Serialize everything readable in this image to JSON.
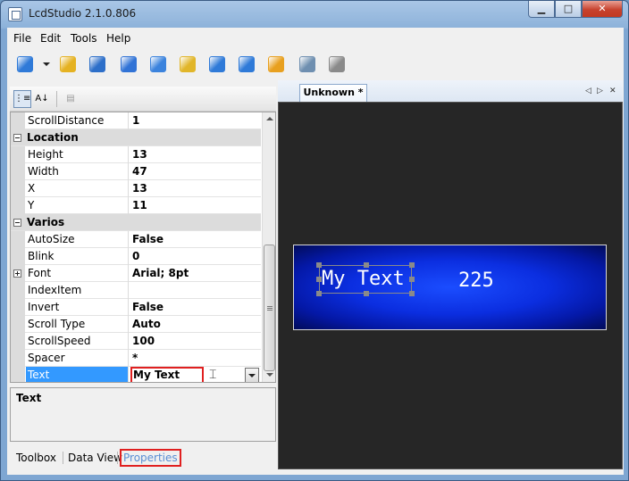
{
  "window": {
    "title": "LcdStudio 2.1.0.806",
    "min_glyph": "▁",
    "max_glyph": "□",
    "close_glyph": "✕"
  },
  "menu": [
    "File",
    "Edit",
    "Tools",
    "Help"
  ],
  "toolbar_icons": [
    {
      "name": "new-icon",
      "color": "#2f7ad8"
    },
    {
      "name": "open-icon",
      "color": "#e5b222"
    },
    {
      "name": "save-icon",
      "color": "#2d6fc9"
    },
    {
      "name": "cut-icon",
      "color": "#3173d6"
    },
    {
      "name": "copy-icon",
      "color": "#3b83dd"
    },
    {
      "name": "paste-icon",
      "color": "#e1b62a"
    },
    {
      "name": "undo-icon",
      "color": "#2f7ad8"
    },
    {
      "name": "redo-icon",
      "color": "#2f7ad8"
    },
    {
      "name": "tools-icon",
      "color": "#e8a01f"
    },
    {
      "name": "print-icon",
      "color": "#6f8fb0"
    },
    {
      "name": "camera-icon",
      "color": "#8a8a8a"
    }
  ],
  "property_grid": {
    "sort_categorized_glyph": "⋮≡",
    "sort_alpha_glyph": "A↓",
    "pages_glyph": "▤",
    "rows": [
      {
        "kind": "prop",
        "name": "ScrollDistance",
        "value": "1"
      },
      {
        "kind": "cat",
        "name": "Location"
      },
      {
        "kind": "prop",
        "name": "Height",
        "value": "13"
      },
      {
        "kind": "prop",
        "name": "Width",
        "value": "47"
      },
      {
        "kind": "prop",
        "name": "X",
        "value": "13"
      },
      {
        "kind": "prop",
        "name": "Y",
        "value": "11"
      },
      {
        "kind": "cat",
        "name": "Varios"
      },
      {
        "kind": "prop",
        "name": "AutoSize",
        "value": "False"
      },
      {
        "kind": "prop",
        "name": "Blink",
        "value": "0"
      },
      {
        "kind": "prop",
        "name": "Font",
        "value": "Arial; 8pt",
        "expandable": true
      },
      {
        "kind": "prop",
        "name": "IndexItem",
        "value": ""
      },
      {
        "kind": "prop",
        "name": "Invert",
        "value": "False"
      },
      {
        "kind": "prop",
        "name": "Scroll Type",
        "value": "Auto"
      },
      {
        "kind": "prop",
        "name": "ScrollSpeed",
        "value": "100"
      },
      {
        "kind": "prop",
        "name": "Spacer",
        "value": "*"
      },
      {
        "kind": "prop",
        "name": "Text",
        "value": "My Text",
        "selected": true
      }
    ],
    "description_title": "Text"
  },
  "bottom_tabs": [
    "Toolbox",
    "Data View",
    "Properties"
  ],
  "active_bottom_tab": "Properties",
  "document": {
    "tab_label": "Unknown *",
    "nav_left": "◁",
    "nav_right": "▷",
    "nav_close": "✕",
    "lcd": {
      "text_element": "My Text",
      "number_element": "225"
    }
  }
}
